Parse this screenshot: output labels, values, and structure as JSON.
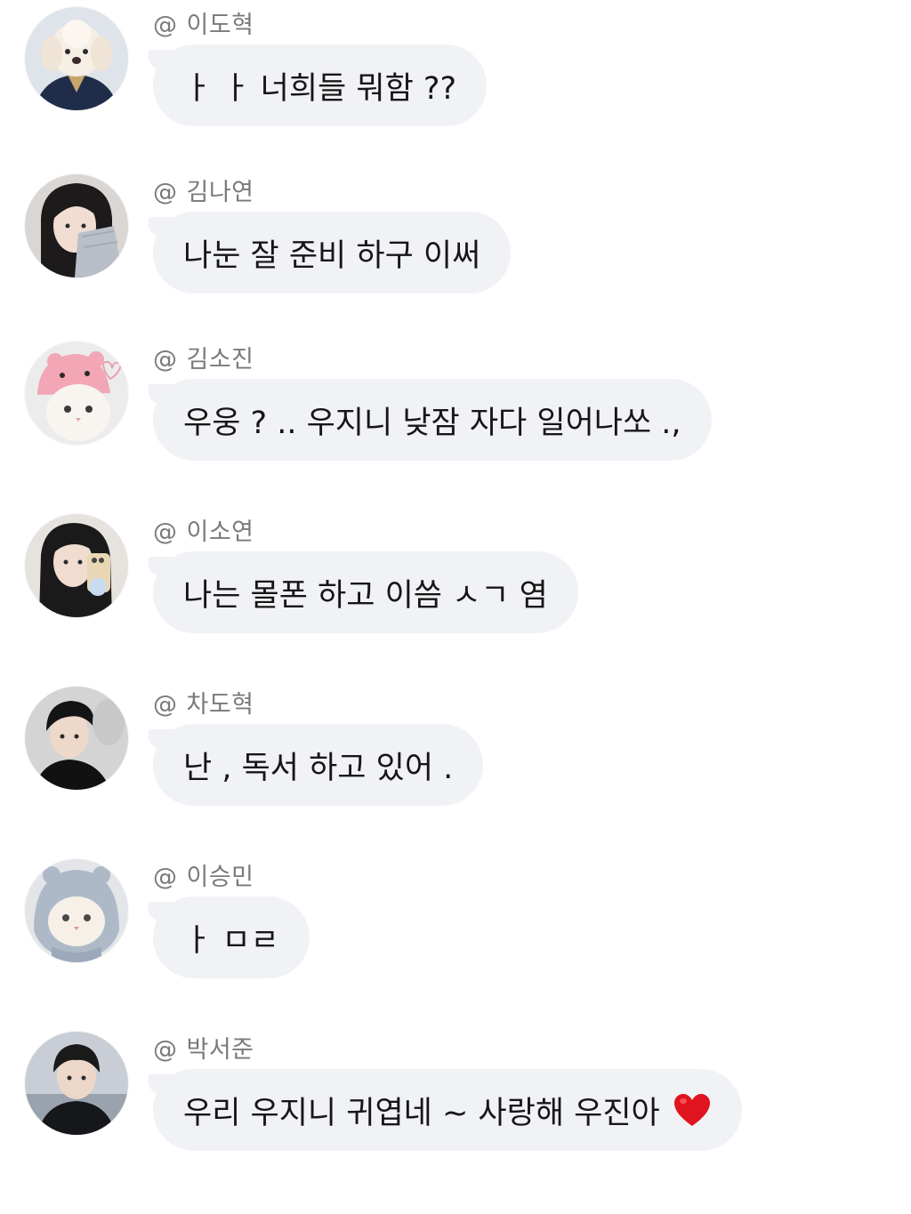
{
  "chat": {
    "messages": [
      {
        "at": "@",
        "sender": "이도혁",
        "text": "ㅏ ㅏ 너희들 뭐함 ??",
        "avatar": "white-puppy-avatar"
      },
      {
        "at": "@",
        "sender": "김나연",
        "text": "나눈 잘 준비 하구 이써",
        "avatar": "girl-portrait-avatar"
      },
      {
        "at": "@",
        "sender": "김소진",
        "text": "우웅 ? .. 우지니 낮잠 자다 일어나쏘 .,",
        "avatar": "cat-pink-hat-avatar"
      },
      {
        "at": "@",
        "sender": "이소연",
        "text": "나는 몰폰 하고 이씀 ㅅㄱ 염",
        "avatar": "girl-mirror-selfie-avatar"
      },
      {
        "at": "@",
        "sender": "차도혁",
        "text": "난 , 독서 하고 있어 .",
        "avatar": "boy-portrait-avatar"
      },
      {
        "at": "@",
        "sender": "이승민",
        "text": "ㅏ ㅁㄹ",
        "avatar": "cat-blue-hood-avatar"
      },
      {
        "at": "@",
        "sender": "박서준",
        "text": "우리 우지니 귀엽네 ~ 사랑해 우진아",
        "avatar": "boy-outdoor-avatar",
        "emoji": "heart-icon"
      }
    ]
  },
  "colors": {
    "bubble": "#f1f2f6",
    "sender": "#7a7a7a",
    "text": "#161616",
    "heart": "#e0141e"
  }
}
